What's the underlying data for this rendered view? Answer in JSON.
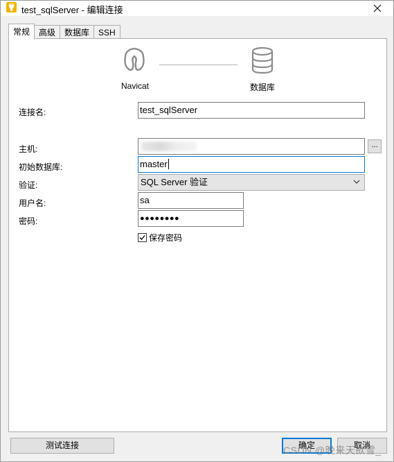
{
  "window": {
    "title": "test_sqlServer - 编辑连接"
  },
  "tabs": [
    {
      "label": "常规",
      "active": true
    },
    {
      "label": "高级",
      "active": false
    },
    {
      "label": "数据库",
      "active": false
    },
    {
      "label": "SSH",
      "active": false
    }
  ],
  "header": {
    "source_label": "Navicat",
    "target_label": "数据库"
  },
  "form": {
    "connection_name_label": "连接名:",
    "connection_name_value": "test_sqlServer",
    "host_label": "主机:",
    "host_value": "",
    "host_browse_label": "...",
    "initial_db_label": "初始数据库:",
    "initial_db_value": "master",
    "auth_label": "验证:",
    "auth_value": "SQL Server 验证",
    "username_label": "用户名:",
    "username_value": "sa",
    "password_label": "密码:",
    "password_value": "●●●●●●●●",
    "save_password_label": "保存密码",
    "save_password_checked": true
  },
  "buttons": {
    "test_connection": "测试连接",
    "ok": "确定",
    "cancel": "取消"
  },
  "watermark": "CSDN @晚来天欲雪_",
  "colors": {
    "accent": "#0078d7",
    "app_icon": "#f4b400"
  },
  "icons": {
    "app": "navicat-app-icon",
    "close": "close-icon",
    "navicat": "navicat-logo-icon",
    "database": "database-icon",
    "dropdown": "chevron-down-icon",
    "check": "checkmark-icon"
  }
}
